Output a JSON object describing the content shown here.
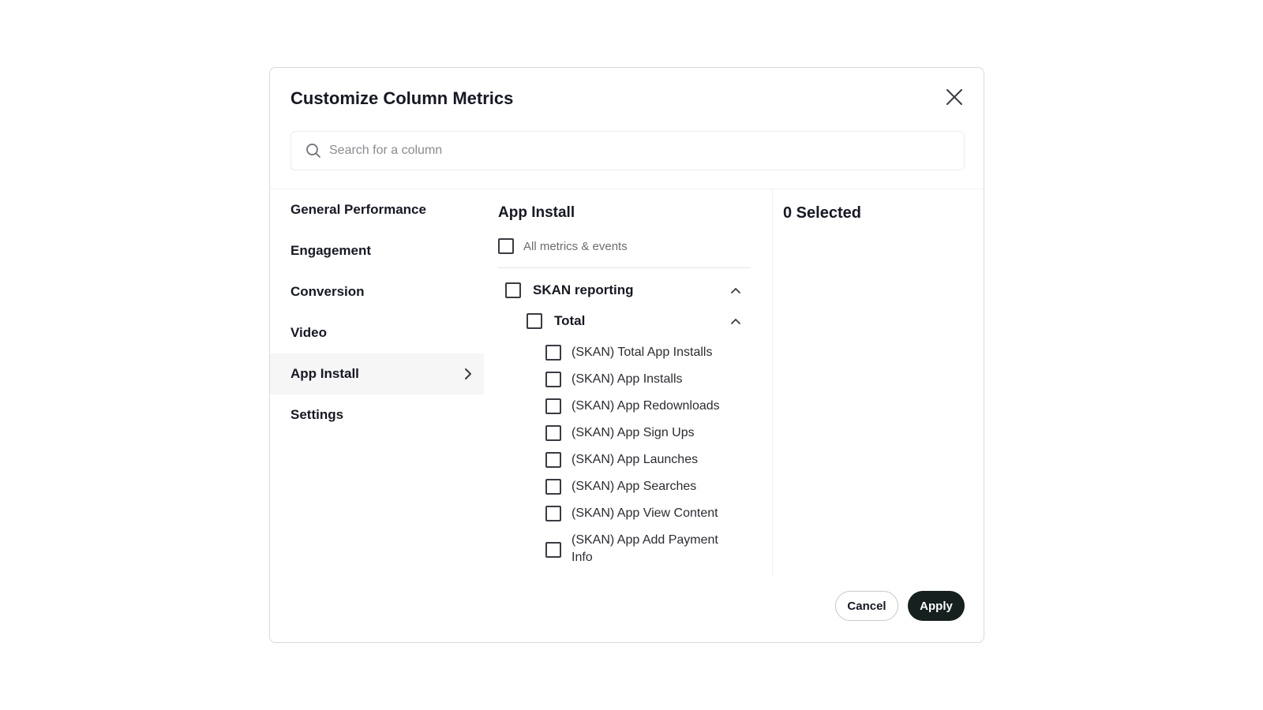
{
  "dialog": {
    "title": "Customize Column Metrics",
    "search_placeholder": "Search for a column"
  },
  "sidebar": {
    "items": [
      {
        "label": "General Performance",
        "active": false
      },
      {
        "label": "Engagement",
        "active": false
      },
      {
        "label": "Conversion",
        "active": false
      },
      {
        "label": "Video",
        "active": false
      },
      {
        "label": "App Install",
        "active": true
      },
      {
        "label": "Settings",
        "active": false
      }
    ]
  },
  "panel": {
    "title": "App Install",
    "all_label": "All metrics & events",
    "group_label": "SKAN reporting",
    "subgroup_label": "Total",
    "metrics": [
      "(SKAN) Total App Installs",
      "(SKAN) App Installs",
      "(SKAN) App Redownloads",
      "(SKAN) App Sign Ups",
      "(SKAN) App Launches",
      "(SKAN) App Searches",
      "(SKAN) App View Content",
      "(SKAN) App Add Payment Info"
    ]
  },
  "selection": {
    "summary": "0 Selected"
  },
  "footer": {
    "cancel_label": "Cancel",
    "apply_label": "Apply"
  },
  "icons": {
    "close": "close-icon",
    "search": "search-icon",
    "chevron_right": "chevron-right-icon",
    "chevron_up": "chevron-up-icon"
  },
  "colors": {
    "primary_button": "#16201e",
    "active_sidebar_bg": "#f6f6f7",
    "text": "#161823"
  }
}
